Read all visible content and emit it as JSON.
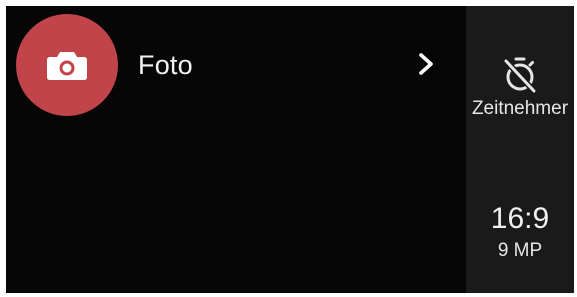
{
  "mode": {
    "label": "Foto",
    "icon": "camera-icon",
    "accent_color": "#c0444a"
  },
  "side_panel": {
    "timer": {
      "label": "Zeitnehmer",
      "icon": "timer-off-icon"
    },
    "aspect_ratio": {
      "value": "16:9",
      "megapixels": "9 MP"
    }
  }
}
